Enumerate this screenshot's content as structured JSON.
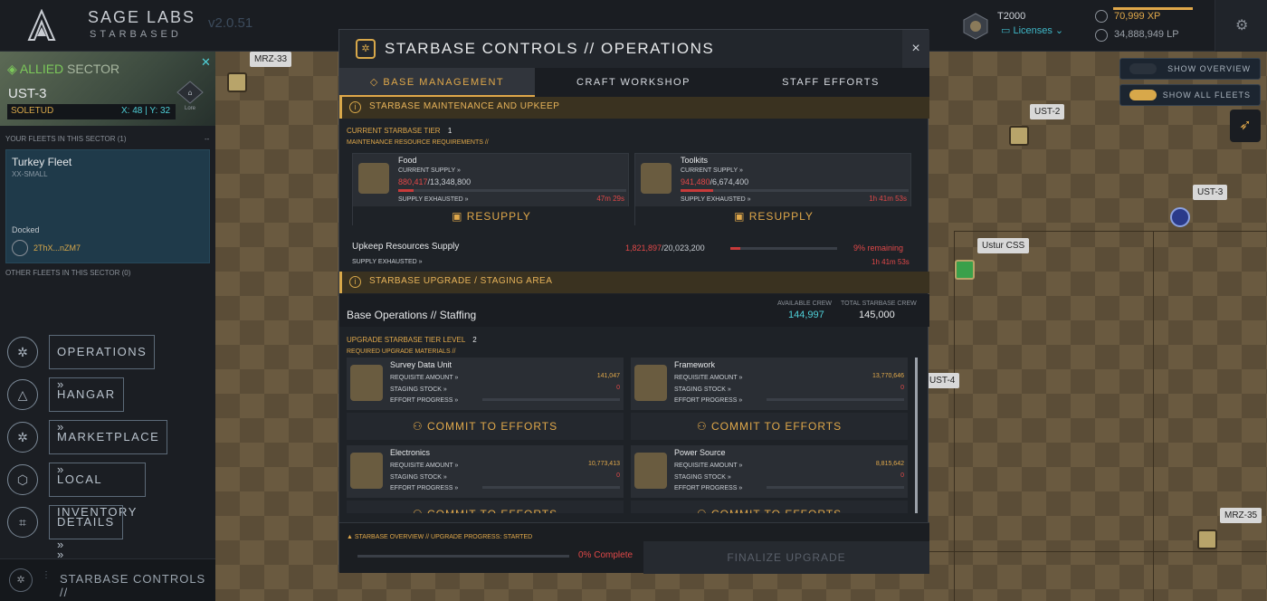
{
  "topbar": {
    "brand_top": "SAGE LABS",
    "brand_bottom": "STARBASED",
    "version": "v2.0.51",
    "player_name": "T2000",
    "licenses_label": "Licenses",
    "xp": "70,999 XP",
    "lp": "34,888,949 LP"
  },
  "sector": {
    "faction_label": "ALLIED",
    "sector_word": "SECTOR",
    "name": "UST-3",
    "faction": "SOLETUD",
    "coords": "X: 48 | Y: 32",
    "lore_label": "Lore"
  },
  "fleets": {
    "header": "YOUR FLEETS IN THIS SECTOR (1)",
    "collapse": "--",
    "fleet_name": "Turkey Fleet",
    "fleet_size": "XX-SMALL",
    "status": "Docked",
    "address": "2ThX...nZM7",
    "other_header": "OTHER FLEETS IN THIS SECTOR (0)"
  },
  "nav": {
    "operations": "OPERATIONS",
    "hangar": "HANGAR",
    "marketplace": "MARKETPLACE",
    "local_inventory": "LOCAL INVENTORY",
    "details": "DETAILS",
    "starbase_controls": "STARBASE CONTROLS //"
  },
  "map": {
    "labels": [
      "MRZ-33",
      "UST-2",
      "UST-3",
      "Ustur CSS",
      "UST-4",
      "MRZ-35"
    ],
    "show_overview": "SHOW OVERVIEW",
    "show_all_fleets": "SHOW ALL FLEETS",
    "show_overview_on": false,
    "show_all_fleets_on": true
  },
  "modal": {
    "title": "STARBASE CONTROLS // OPERATIONS",
    "close": "×",
    "tabs": [
      "BASE MANAGEMENT",
      "CRAFT WORKSHOP",
      "STAFF EFFORTS"
    ],
    "active_tab": "BASE MANAGEMENT",
    "maint": {
      "header": "STARBASE MAINTENANCE AND UPKEEP",
      "tier_label": "CURRENT STARBASE TIER",
      "tier": "1",
      "req_label": "MAINTENANCE RESOURCE REQUIREMENTS //",
      "food": {
        "name": "Food",
        "supply_label": "CURRENT SUPPLY",
        "current": "880,417",
        "total": "/13,348,800",
        "fraction": 0.066,
        "exhausted_label": "SUPPLY EXHAUSTED",
        "time": "47m 29s",
        "resupply": "RESUPPLY"
      },
      "toolkits": {
        "name": "Toolkits",
        "supply_label": "CURRENT SUPPLY",
        "current": "941,480",
        "total": "/6,674,400",
        "fraction": 0.141,
        "exhausted_label": "SUPPLY EXHAUSTED",
        "time": "1h 41m 53s",
        "resupply": "RESUPPLY"
      },
      "upkeep_label": "Upkeep Resources Supply",
      "upkeep_current": "1,821,897",
      "upkeep_total": "/20,023,200",
      "upkeep_fraction": 0.09,
      "upkeep_remaining": "9% remaining",
      "upkeep_exhausted_label": "SUPPLY EXHAUSTED",
      "upkeep_time": "1h 41m 53s"
    },
    "upgrade": {
      "header": "STARBASE UPGRADE / STAGING AREA",
      "staffing_label": "Base Operations // Staffing",
      "available_crew_label": "AVAILABLE CREW",
      "available_crew": "144,997",
      "total_crew_label": "TOTAL STARBASE CREW",
      "total_crew": "145,000",
      "level_label": "UPGRADE STARBASE TIER LEVEL",
      "level": "2",
      "materials_label": "REQUIRED UPGRADE MATERIALS //",
      "req_label": "REQUISITE AMOUNT",
      "stock_label": "STAGING STOCK",
      "progress_label": "EFFORT PROGRESS",
      "commit": "COMMIT TO EFFORTS",
      "items": [
        {
          "name": "Survey Data Unit",
          "amount": "141,047",
          "stock": "0"
        },
        {
          "name": "Framework",
          "amount": "13,770,646",
          "stock": "0"
        },
        {
          "name": "Electronics",
          "amount": "10,773,413",
          "stock": "0"
        },
        {
          "name": "Power Source",
          "amount": "8,815,642",
          "stock": "0"
        }
      ]
    },
    "footer": {
      "status": "STARBASE OVERVIEW // UPGRADE PROGRESS: STARTED",
      "complete": "0% Complete",
      "finalize": "FINALIZE UPGRADE"
    }
  }
}
